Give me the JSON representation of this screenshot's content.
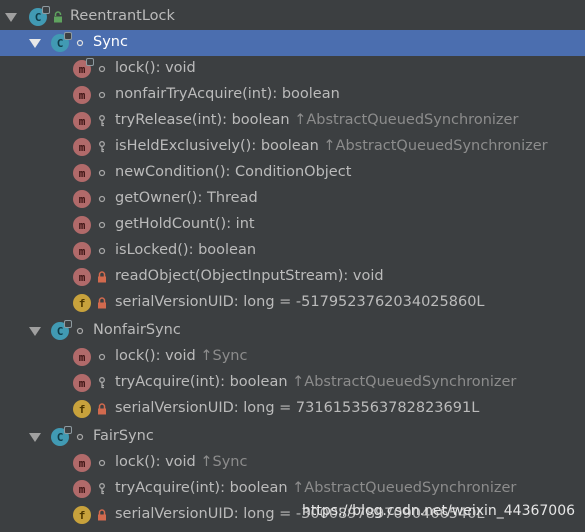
{
  "tree": {
    "root": {
      "label": "ReentrantLock"
    },
    "sync": {
      "label": "Sync",
      "members": [
        {
          "label": "lock(): void",
          "inherited": ""
        },
        {
          "label": "nonfairTryAcquire(int): boolean",
          "inherited": ""
        },
        {
          "label": "tryRelease(int): boolean ",
          "inherited": "↑AbstractQueuedSynchronizer"
        },
        {
          "label": "isHeldExclusively(): boolean ",
          "inherited": "↑AbstractQueuedSynchronizer"
        },
        {
          "label": "newCondition(): ConditionObject",
          "inherited": ""
        },
        {
          "label": "getOwner(): Thread",
          "inherited": ""
        },
        {
          "label": "getHoldCount(): int",
          "inherited": ""
        },
        {
          "label": "isLocked(): boolean",
          "inherited": ""
        },
        {
          "label": "readObject(ObjectInputStream): void",
          "inherited": ""
        },
        {
          "label": "serialVersionUID: long = -5179523762034025860L",
          "inherited": ""
        }
      ]
    },
    "nonfair": {
      "label": "NonfairSync",
      "members": [
        {
          "label": "lock(): void ",
          "inherited": "↑Sync"
        },
        {
          "label": "tryAcquire(int): boolean ",
          "inherited": "↑AbstractQueuedSynchronizer"
        },
        {
          "label": "serialVersionUID: long = 7316153563782823691L",
          "inherited": ""
        }
      ]
    },
    "fair": {
      "label": "FairSync",
      "members": [
        {
          "label": "lock(): void ",
          "inherited": "↑Sync"
        },
        {
          "label": "tryAcquire(int): boolean ",
          "inherited": "↑AbstractQueuedSynchronizer"
        },
        {
          "label": "serialVersionUID: long = -3000897897090466540L",
          "inherited": ""
        }
      ]
    }
  },
  "icons": {
    "c": "C",
    "m": "m",
    "f": "f"
  },
  "watermark": "https://blog.csdn.net/weixin_44367006",
  "colors": {
    "background": "#3c3f41",
    "selection": "#4b6eaf",
    "text": "#bbbbbb",
    "inherited": "#8c8c8c",
    "class_icon": "#419ab3",
    "method_icon": "#b16a6a",
    "field_icon": "#c8a23c",
    "lock_icon": "#d26a4e"
  }
}
